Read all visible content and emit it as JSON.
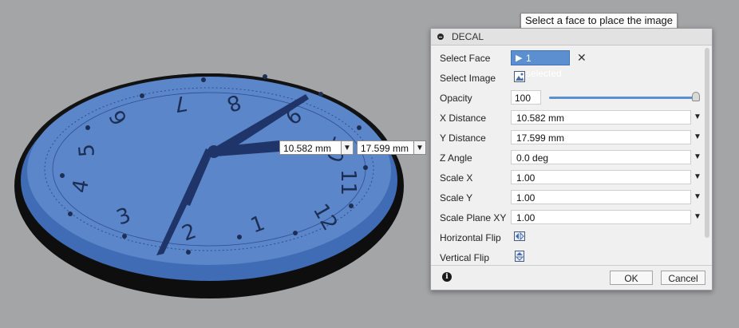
{
  "tooltip": "Select a face to place the image",
  "viewport": {
    "x_distance_value": "10.582 mm",
    "y_distance_value": "17.599 mm",
    "dropdown_glyph": "▼"
  },
  "panel": {
    "title": "DECAL",
    "rows": {
      "select_face": {
        "label": "Select Face",
        "value": "1 selected",
        "clear": "✕"
      },
      "select_image": {
        "label": "Select Image"
      },
      "opacity": {
        "label": "Opacity",
        "value": "100"
      },
      "x_distance": {
        "label": "X Distance",
        "value": "10.582 mm"
      },
      "y_distance": {
        "label": "Y Distance",
        "value": "17.599 mm"
      },
      "z_angle": {
        "label": "Z Angle",
        "value": "0.0 deg"
      },
      "scale_x": {
        "label": "Scale X",
        "value": "1.00"
      },
      "scale_y": {
        "label": "Scale Y",
        "value": "1.00"
      },
      "scale_plane_xy": {
        "label": "Scale Plane XY",
        "value": "1.00"
      },
      "horizontal_flip": {
        "label": "Horizontal Flip"
      },
      "vertical_flip": {
        "label": "Vertical Flip"
      }
    },
    "caret": "▼",
    "ok": "OK",
    "cancel": "Cancel",
    "info": "i"
  },
  "colors": {
    "background": "#a4a5a7",
    "clock_face": "#5b86c9",
    "selection": "#5b8fcf",
    "rim": "#121212"
  },
  "icons": {
    "cursor": "arrow-cursor-icon",
    "image": "image-icon",
    "horizontal_flip": "horizontal-flip-icon",
    "vertical_flip": "vertical-flip-icon",
    "info": "info-icon"
  },
  "clock_numerals": [
    "1",
    "2",
    "3",
    "4",
    "5",
    "6",
    "7",
    "8",
    "9",
    "10",
    "11",
    "12"
  ]
}
